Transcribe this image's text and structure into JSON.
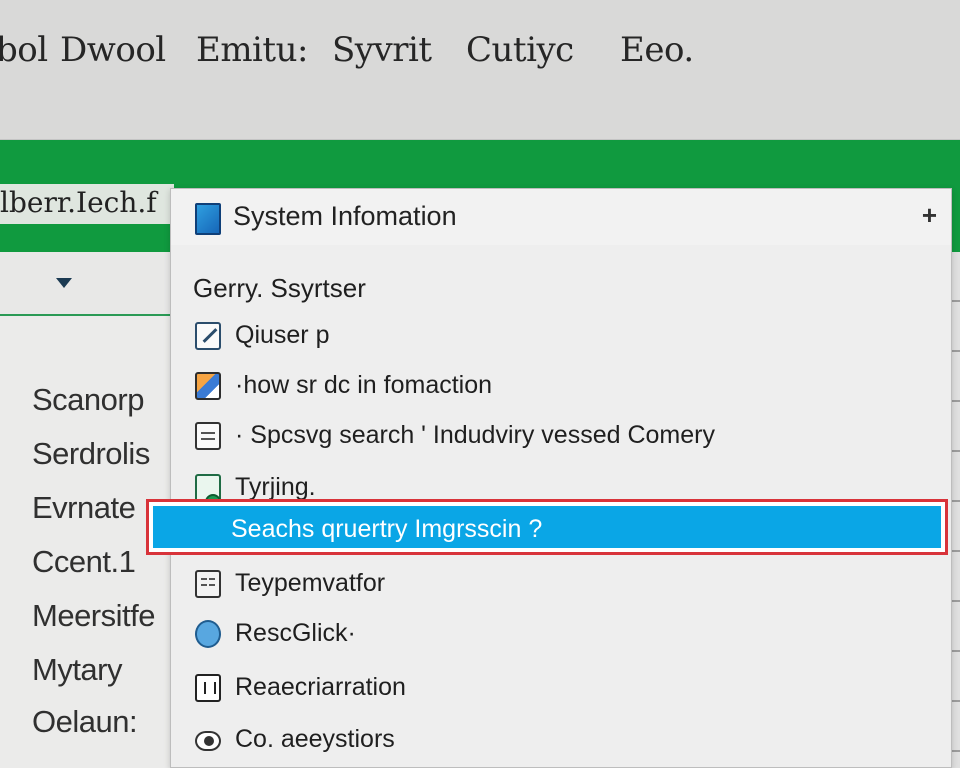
{
  "menubar": {
    "items": [
      "bol",
      "Dwool",
      "Emitu:",
      "Syvrit",
      "Cutiyc",
      "Eeo."
    ]
  },
  "greenbar": {
    "title": "lberr.Iech.f"
  },
  "left_pane": {
    "items": [
      "Scanorp",
      "Serdrolis",
      "Evrnate",
      "Ccent.1",
      "Meersitfe",
      "Mytary",
      "Oelaun:"
    ]
  },
  "panel": {
    "title": "System Infomation",
    "plus": "+",
    "section_label": "Gerry. Ssyrtser",
    "items": [
      {
        "label": "Qiuser  p",
        "icon": "pen-icon"
      },
      {
        "label": "·how sr dc  in fomaction",
        "icon": "document-color-icon"
      },
      {
        "label": "· Spcsvg  search  ' Indudviry vessed Comery",
        "icon": "list-document-icon"
      },
      {
        "label": "Tyrjing.",
        "icon": "terminal-icon"
      }
    ],
    "highlight_text": "Seachs qruertry Imgrsscin ?",
    "items_after": [
      {
        "label": "Teypemvatfor",
        "icon": "grid-icon"
      },
      {
        "label": "RescGlick·",
        "icon": "click-icon"
      },
      {
        "label": "Reaecriarration",
        "icon": "frame-icon"
      },
      {
        "label": "Co. aeeystiors",
        "icon": "eye-icon"
      }
    ]
  },
  "colors": {
    "green": "#109a3f",
    "highlight": "#0aa6e6",
    "highlight_border": "#d8333a"
  }
}
